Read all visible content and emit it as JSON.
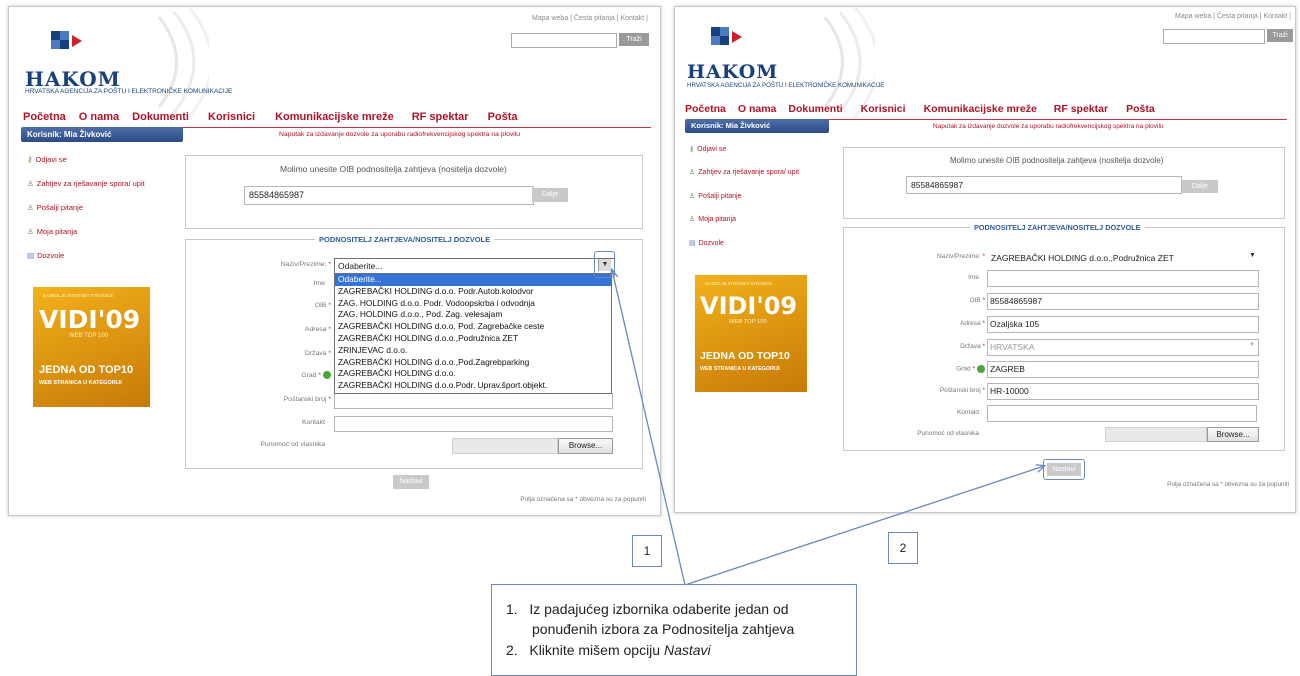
{
  "site": {
    "top_links": "Mapa weba | Česta pitanja | Kontakt |",
    "search_button": "Traži",
    "logo_name": "HAKOM",
    "logo_subtitle": "HRVATSKA AGENCIJA ZA POŠTU I ELEKTRONIČKE KOMUNIKACIJE",
    "nav": [
      "Početna",
      "O nama",
      "Dokumenti",
      "Korisnici",
      "Komunikacijske mreže",
      "RF spektar",
      "Pošta"
    ],
    "user_bar": "Korisnik: Mia Živković",
    "hint": "Naputak za izdavanje dozvole za uporabu radiofrekvencijskog spektra na plovilu",
    "sidebar": [
      "Odjavi se",
      "Zahtjev za rješavanje spora/ upit",
      "Pošalji pitanje",
      "Moja pitanja",
      "Dozvole"
    ],
    "banner": {
      "small_top": "NAJBOLJE INTERNET STRANICE",
      "brand": "VIDI'09",
      "webtop": "WEB TOP 100",
      "line1": "JEDNA OD TOP10",
      "line2": "WEB STRANICA U KATEGORIJI"
    }
  },
  "form": {
    "oib_prompt": "Molimo unesite OIB podnositelja zahtjeva (nositelja dozvole)",
    "oib_value": "85584865987",
    "dalje_button": "Dalje",
    "section_title": "PODNOSITELJ ZAHTJEVA/NOSITELJ DOZVOLE",
    "labels": {
      "naziv": "Naziv/Prezime:",
      "ime": "Ime",
      "oib": "OIB",
      "adresa": "Adresa",
      "drzava": "Država",
      "grad": "Grad",
      "postanski": "Poštanski broj",
      "kontakt": "Kontakt",
      "punomoc": "Punomoć od vlasnika"
    },
    "required_mark": "*",
    "browse_button": "Browse...",
    "nastavi_button": "Nastavi",
    "footnote": "Polja označena sa * obvezna su za popuniti"
  },
  "panel1": {
    "select_value": "Odaberite...",
    "dropdown_options": [
      "Odaberite...",
      "ZAGREBAČKI HOLDING d.o.o. Podr.Autob.kolodvor",
      "ZAG. HOLDING d.o.o. Podr. Vodoopskrba i odvodnja",
      "ZAG. HOLDING d.o.o., Pod. Zag. velesajam",
      "ZAGREBAČKI HOLDING d.o.o. Pod. Zagrebačke ceste",
      "ZAGREBAČKI HOLDING d.o.o.,Podružnica ZET",
      "ZRINJEVAC d.o.o.",
      "ZAGREBAČKI HOLDING d.o.o.,Pod.Zagrebparking",
      "ZAGREBAČKI HOLDING d.o.o.",
      "ZAGREBAČKI HOLDING d.o.o.Podr. Uprav.šport.objekt."
    ],
    "selected_index": 0
  },
  "panel2": {
    "select_value": "ZAGREBAČKI HOLDING d.o.o.,Podružnica ZET",
    "oib": "85584865987",
    "adresa": "Ozaljska 105",
    "drzava": "HRVATSKA",
    "grad": "ZAGREB",
    "postanski": "HR-10000"
  },
  "callouts": {
    "step1": "1",
    "step2": "2",
    "instructions": [
      {
        "num": "1.",
        "text": "Iz padajućeg izbornika odaberite jedan od"
      },
      {
        "num": "",
        "text": "ponuđenih izbora za Podnositelja zahtjeva"
      },
      {
        "num": "2.",
        "text": "Kliknite mišem opciju ",
        "em": "Nastavi"
      }
    ]
  },
  "colors": {
    "nav_red": "#b01226",
    "logo_blue": "#17407e",
    "userbar_blue": "#2d4b86",
    "callout_blue": "#6a87c0",
    "dropdown_selected": "#3373d4"
  }
}
